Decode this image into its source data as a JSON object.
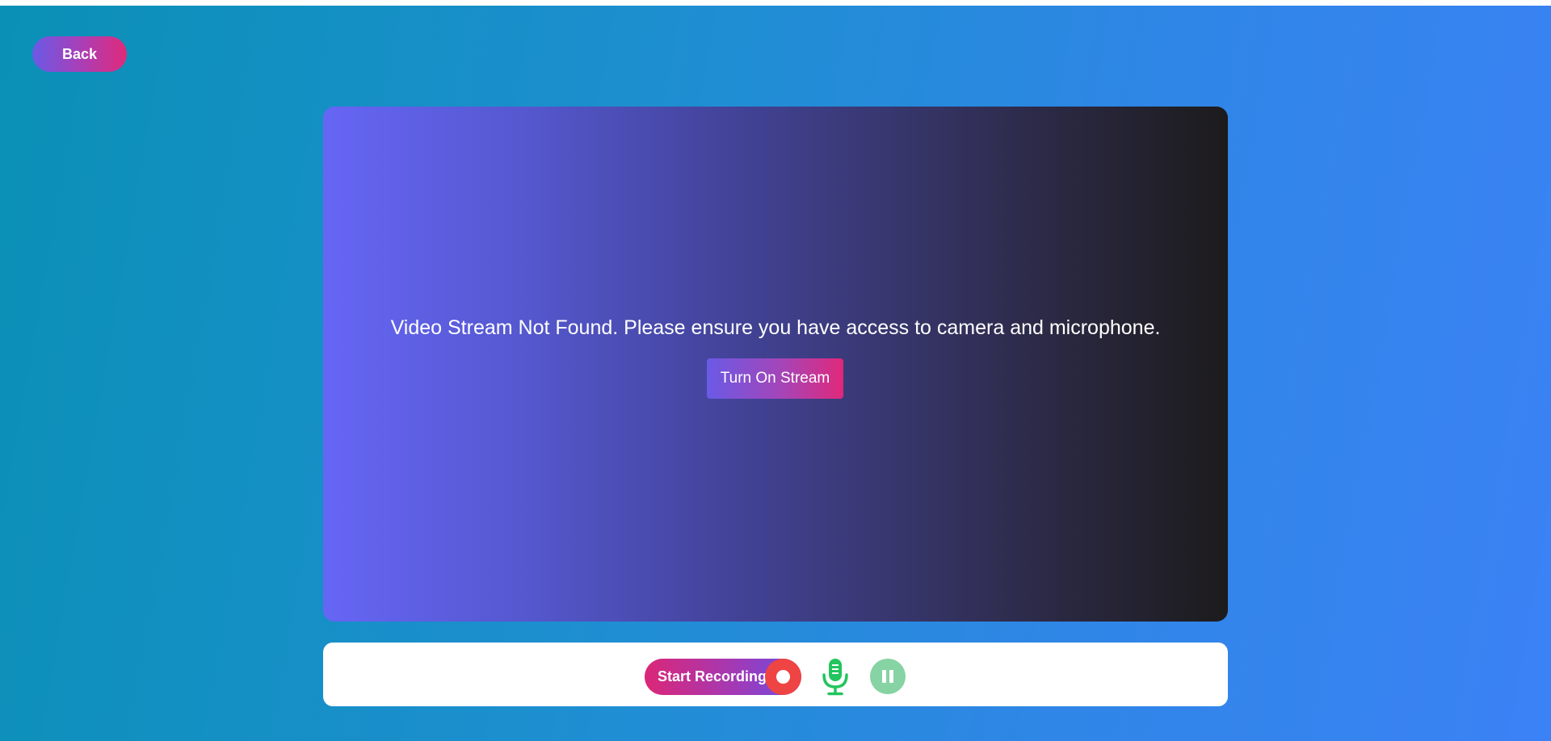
{
  "header": {
    "back_label": "Back"
  },
  "video": {
    "message": "Video Stream Not Found. Please ensure you have access to camera and microphone.",
    "turn_on_label": "Turn On Stream"
  },
  "controls": {
    "start_recording_label": "Start Recording",
    "record_icon": "record-dot-icon",
    "mic_icon": "microphone-icon",
    "pause_icon": "pause-icon"
  },
  "colors": {
    "record": "#ef4444",
    "mic": "#22c55e",
    "pause": "#86d3a3"
  }
}
